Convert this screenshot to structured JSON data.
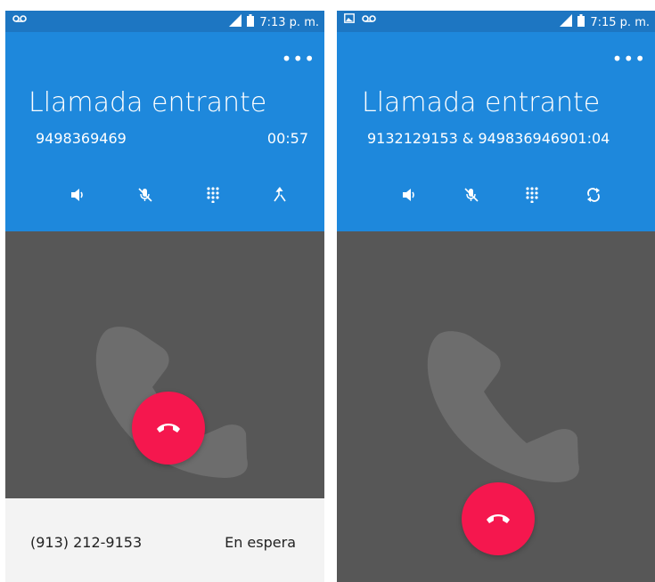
{
  "colors": {
    "status_bar": "#1d76c2",
    "header": "#1e88dc",
    "call_body": "#575757",
    "end_call": "#f5174e",
    "hold_bar": "#f3f3f3"
  },
  "screens": [
    {
      "status_bar": {
        "time": "7:13 p. m.",
        "icons": [
          "voicemail-icon",
          "signal-icon",
          "battery-icon"
        ]
      },
      "overflow_label": "•••",
      "title": "Llamada entrante",
      "caller": "9498369469",
      "timer": "00:57",
      "controls": [
        "speaker-icon",
        "mute-icon",
        "dialpad-icon",
        "merge-call-icon"
      ],
      "held_call": {
        "number": "(913) 212-9153",
        "status": "En espera"
      }
    },
    {
      "status_bar": {
        "time": "7:15 p. m.",
        "icons": [
          "image-icon",
          "voicemail-icon",
          "signal-icon",
          "battery-icon"
        ]
      },
      "overflow_label": "•••",
      "title": "Llamada entrante",
      "caller": "9132129153 & 9498369469",
      "timer": "01:04",
      "controls": [
        "speaker-icon",
        "mute-icon",
        "dialpad-icon",
        "swap-call-icon"
      ]
    }
  ]
}
